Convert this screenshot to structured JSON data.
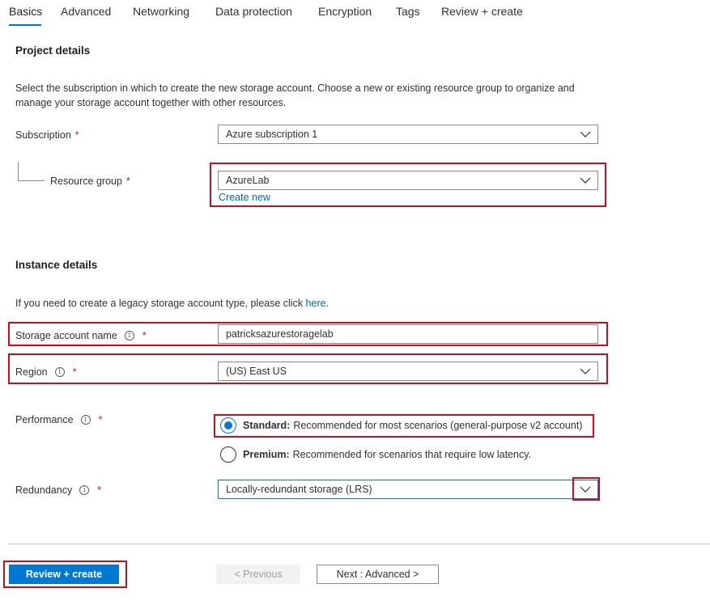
{
  "tabs": [
    {
      "label": "Basics",
      "active": true
    },
    {
      "label": "Advanced"
    },
    {
      "label": "Networking"
    },
    {
      "label": "Data protection"
    },
    {
      "label": "Encryption"
    },
    {
      "label": "Tags"
    },
    {
      "label": "Review + create"
    }
  ],
  "project": {
    "title": "Project details",
    "description": "Select the subscription in which to create the new storage account. Choose a new or existing resource group to organize and manage your storage account together with other resources.",
    "subscription_label": "Subscription",
    "subscription_value": "Azure subscription 1",
    "resource_group_label": "Resource group",
    "resource_group_value": "AzureLab",
    "create_new": "Create new"
  },
  "instance": {
    "title": "Instance details",
    "legacy_text": "If you need to create a legacy storage account type, please click ",
    "legacy_link": "here",
    "legacy_end": ".",
    "name_label": "Storage account name",
    "name_value": "patricksazurestoragelab",
    "region_label": "Region",
    "region_value": "(US) East US",
    "performance_label": "Performance",
    "standard_title": "Standard:",
    "standard_desc": "Recommended for most scenarios (general-purpose v2 account)",
    "premium_title": "Premium:",
    "premium_desc": "Recommended for scenarios that require low latency.",
    "redundancy_label": "Redundancy",
    "redundancy_value": "Locally-redundant storage (LRS)"
  },
  "required_mark": "*",
  "info_glyph": "i",
  "footer": {
    "review_create": "Review + create",
    "previous": "< Previous",
    "next": "Next : Advanced >"
  },
  "colors": {
    "accent": "#0078d4",
    "highlight": "#c50f1f",
    "link": "#0067b8"
  }
}
